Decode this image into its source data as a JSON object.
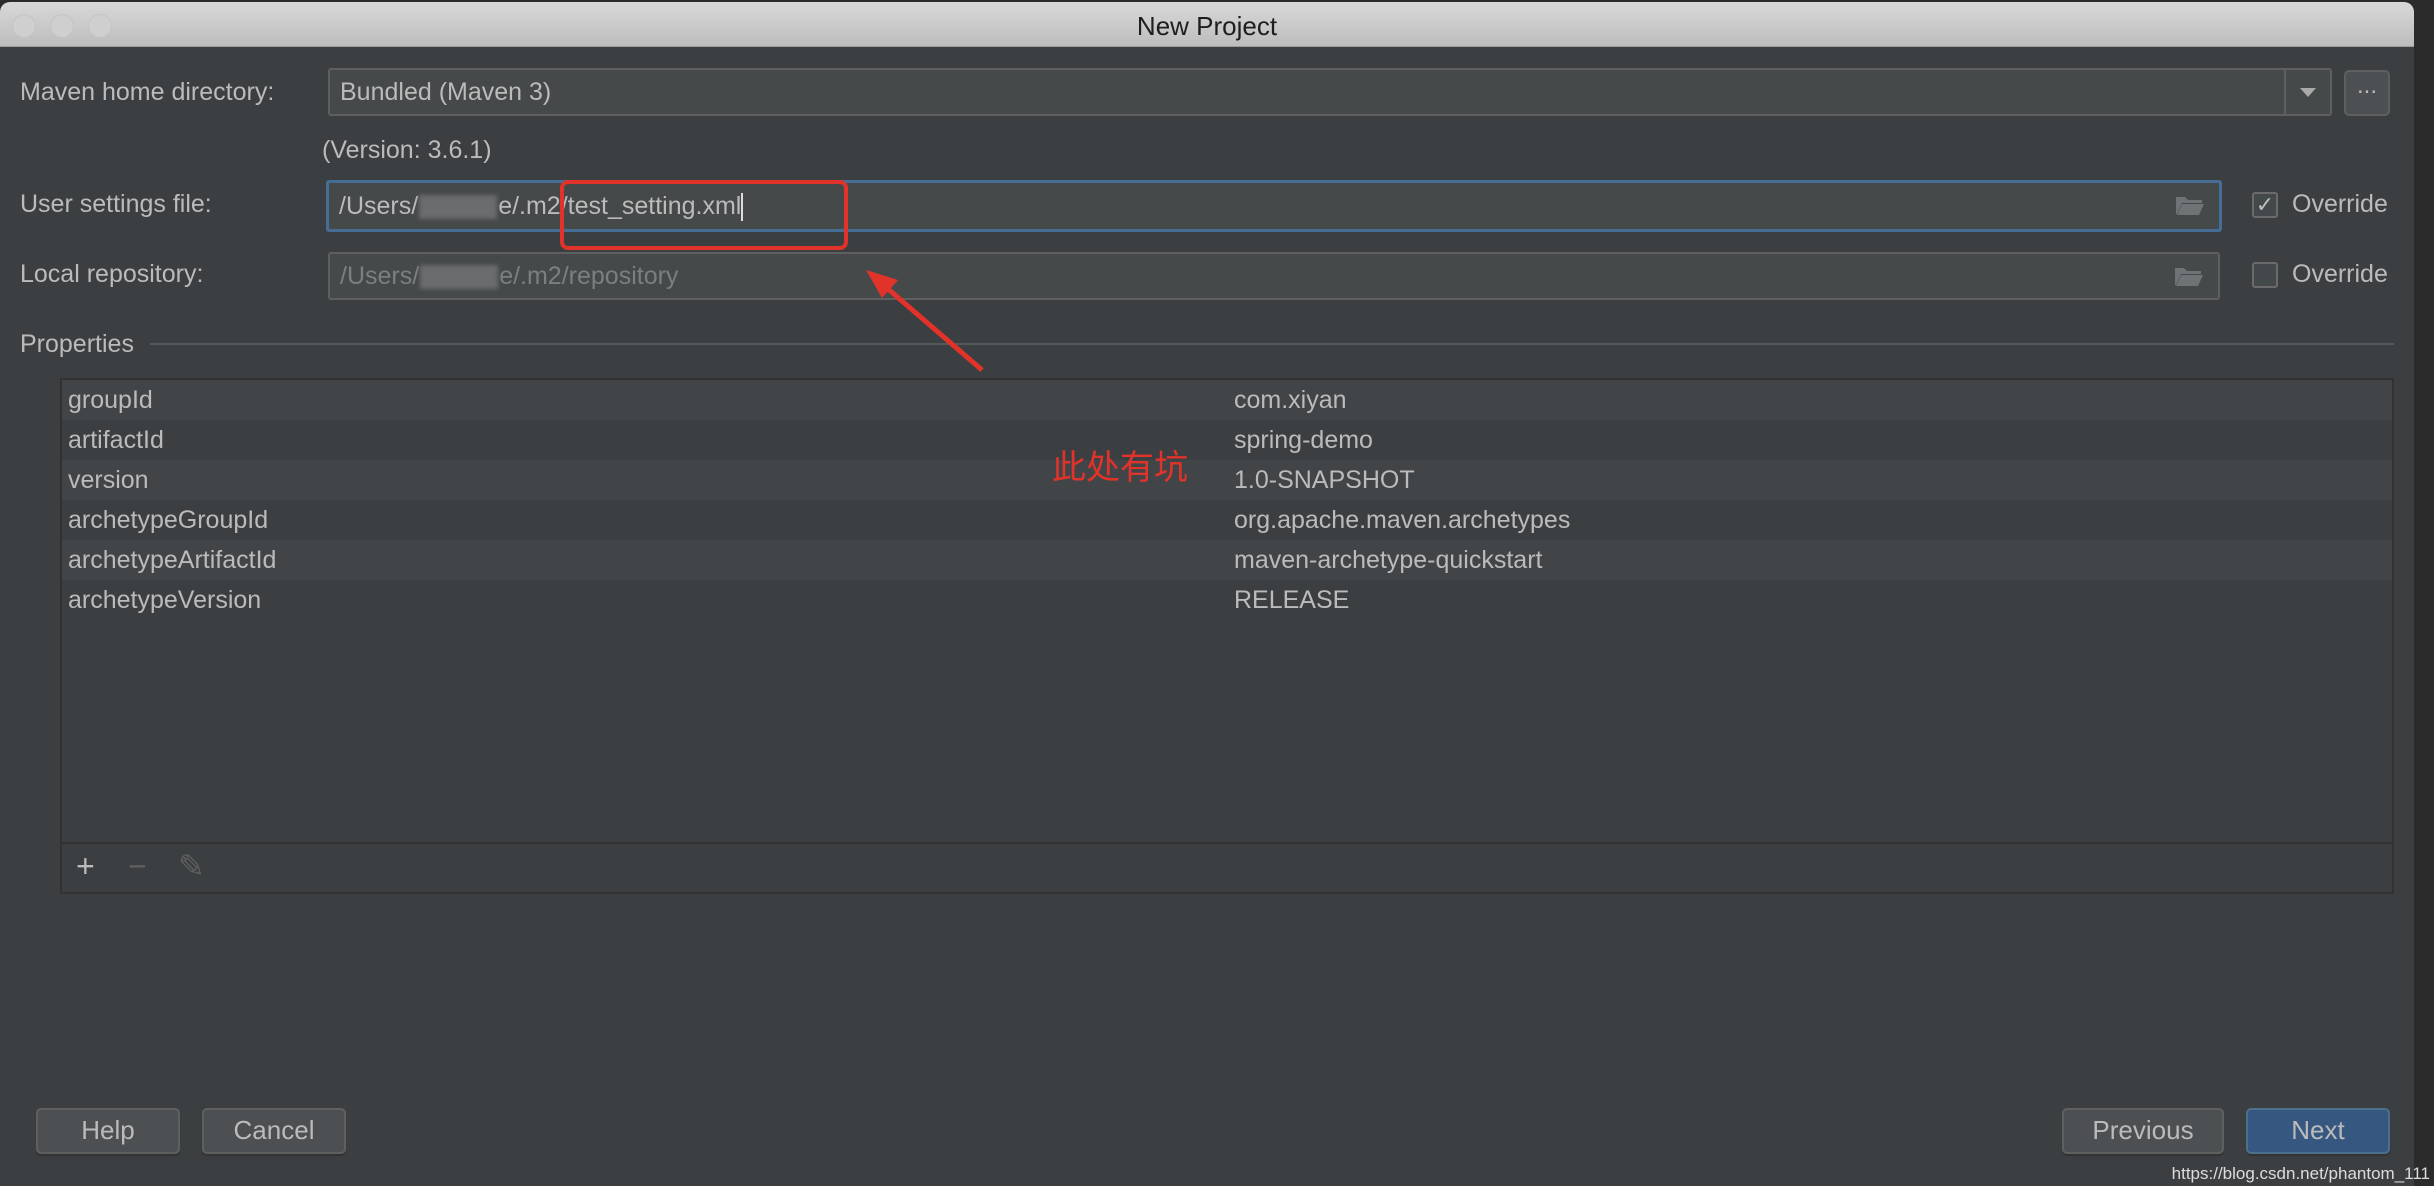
{
  "window": {
    "title": "New Project"
  },
  "maven_home": {
    "label": "Maven home directory:",
    "value": "Bundled (Maven 3)",
    "browse_label": "...",
    "version_note": "(Version: 3.6.1)"
  },
  "user_settings": {
    "label": "User settings file:",
    "value_prefix": "/Users/",
    "value_suffix": "e/.m2/test_setting.xml",
    "override_label": "Override",
    "override_checked": true,
    "check_glyph": "✓"
  },
  "local_repository": {
    "label": "Local repository:",
    "value_prefix": "/Users/",
    "value_suffix": "e/.m2/repository",
    "override_label": "Override",
    "override_checked": false
  },
  "properties": {
    "section_label": "Properties",
    "rows": [
      {
        "key": "groupId",
        "value": "com.xiyan"
      },
      {
        "key": "artifactId",
        "value": "spring-demo"
      },
      {
        "key": "version",
        "value": "1.0-SNAPSHOT"
      },
      {
        "key": "archetypeGroupId",
        "value": "org.apache.maven.archetypes"
      },
      {
        "key": "archetypeArtifactId",
        "value": "maven-archetype-quickstart"
      },
      {
        "key": "archetypeVersion",
        "value": "RELEASE"
      }
    ],
    "toolbar": {
      "add": "+",
      "remove": "−",
      "edit": "✎"
    }
  },
  "buttons": {
    "help": "Help",
    "cancel": "Cancel",
    "previous": "Previous",
    "next": "Next"
  },
  "annotation": {
    "text": "此处有坑",
    "color": "#e2332b"
  },
  "watermark": "https://blog.csdn.net/phantom_111"
}
